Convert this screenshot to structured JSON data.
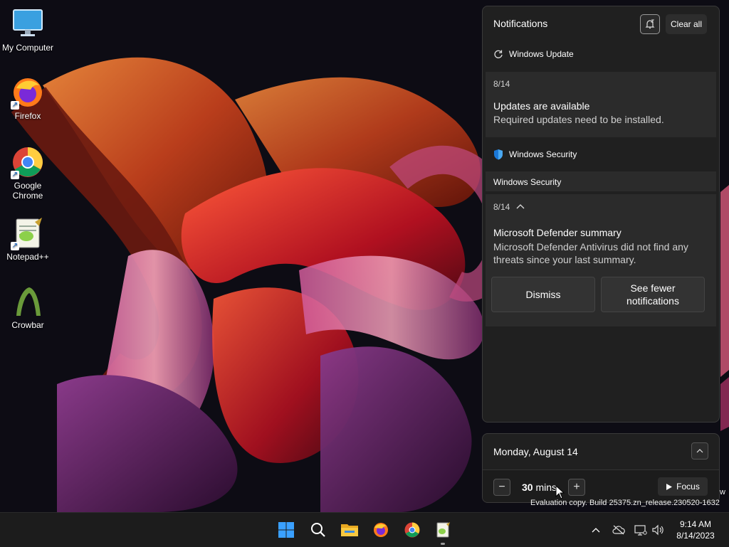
{
  "desktop": {
    "icons": [
      {
        "label": "My Computer"
      },
      {
        "label": "Firefox"
      },
      {
        "label": "Google\nChrome"
      },
      {
        "label": "Notepad++"
      },
      {
        "label": "Crowbar"
      }
    ]
  },
  "notifications": {
    "header": "Notifications",
    "clear_all": "Clear all",
    "groups": [
      {
        "app": "Windows Update",
        "date": "8/14",
        "title": "Updates are available",
        "body": "Required updates need to be installed."
      },
      {
        "app": "Windows Security",
        "subheader": "Windows Security",
        "date": "8/14",
        "title": "Microsoft Defender summary",
        "body": "Microsoft Defender Antivirus did not find any threats since your last summary.",
        "actions": [
          "Dismiss",
          "See fewer notifications"
        ]
      }
    ]
  },
  "calendar": {
    "date": "Monday, August 14",
    "focus_minutes": "30",
    "focus_unit": "mins",
    "focus_label": "Focus"
  },
  "watermark": {
    "text": "Evaluation copy. Build 25375.zn_release.230520-1632",
    "partial": "w"
  },
  "taskbar": {
    "time": "9:14 AM",
    "date": "8/14/2023"
  },
  "colors": {
    "accent": "#0078d4",
    "panel_bg": "#202020",
    "card_bg": "#2b2b2b"
  }
}
